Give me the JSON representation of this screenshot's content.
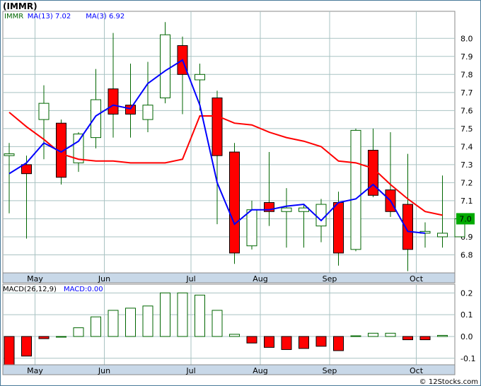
{
  "ticker_label": "(IMMR)",
  "watermark": "© 12Stocks.com",
  "colors": {
    "up_fill": "#ffffff",
    "up_stroke": "#006600",
    "down_fill": "#ff0000",
    "wick": "#006600",
    "ma13": "#ff0000",
    "ma3": "#0000ff",
    "grid": "#a9c3c3",
    "panel_bg": "#ffffff",
    "axis_band": "#c8d8e8",
    "last_price_box": "#00aa00"
  },
  "chart_data": [
    {
      "type": "candlestick",
      "title": "",
      "legend": [
        {
          "label": "IMMR",
          "value": "",
          "color": "#006600"
        },
        {
          "label": "MA(13)",
          "value": "7.02",
          "color": "#0000ff"
        },
        {
          "label": "MA(3)",
          "value": "6.92",
          "color": "#0000ff"
        }
      ],
      "ylim": [
        6.7,
        8.15
      ],
      "yticks": [
        "6.8",
        "6.9",
        "7.0",
        "7.1",
        "7.2",
        "7.3",
        "7.4",
        "7.5",
        "7.6",
        "7.7",
        "7.8",
        "7.9",
        "8.0"
      ],
      "xlabels": [
        {
          "label": "May",
          "index": 1
        },
        {
          "label": "Jun",
          "index": 5
        },
        {
          "label": "Jul",
          "index": 10
        },
        {
          "label": "Aug",
          "index": 14
        },
        {
          "label": "Sep",
          "index": 18
        },
        {
          "label": "Oct",
          "index": 23
        }
      ],
      "last_price": "7.0",
      "candles": [
        {
          "o": 7.35,
          "h": 7.42,
          "l": 7.03,
          "c": 7.36
        },
        {
          "o": 7.3,
          "h": 7.35,
          "l": 6.89,
          "c": 7.25
        },
        {
          "o": 7.55,
          "h": 7.74,
          "l": 7.33,
          "c": 7.64
        },
        {
          "o": 7.53,
          "h": 7.55,
          "l": 7.19,
          "c": 7.23
        },
        {
          "o": 7.31,
          "h": 7.48,
          "l": 7.26,
          "c": 7.47
        },
        {
          "o": 7.45,
          "h": 7.83,
          "l": 7.39,
          "c": 7.66
        },
        {
          "o": 7.72,
          "h": 8.03,
          "l": 7.45,
          "c": 7.58
        },
        {
          "o": 7.63,
          "h": 7.86,
          "l": 7.45,
          "c": 7.58
        },
        {
          "o": 7.55,
          "h": 7.87,
          "l": 7.48,
          "c": 7.63
        },
        {
          "o": 7.67,
          "h": 8.09,
          "l": 7.64,
          "c": 8.02
        },
        {
          "o": 7.96,
          "h": 8.01,
          "l": 7.58,
          "c": 7.8
        },
        {
          "o": 7.77,
          "h": 7.86,
          "l": 7.6,
          "c": 7.8
        },
        {
          "o": 7.67,
          "h": 7.71,
          "l": 6.97,
          "c": 7.35
        },
        {
          "o": 7.37,
          "h": 7.42,
          "l": 6.75,
          "c": 6.81
        },
        {
          "o": 6.85,
          "h": 7.1,
          "l": 6.83,
          "c": 7.05
        },
        {
          "o": 7.09,
          "h": 7.37,
          "l": 6.96,
          "c": 7.04
        },
        {
          "o": 7.04,
          "h": 7.17,
          "l": 6.84,
          "c": 7.06
        },
        {
          "o": 7.04,
          "h": 7.08,
          "l": 6.84,
          "c": 7.06
        },
        {
          "o": 6.96,
          "h": 7.11,
          "l": 6.87,
          "c": 7.08
        },
        {
          "o": 7.09,
          "h": 7.15,
          "l": 6.74,
          "c": 6.81
        },
        {
          "o": 6.83,
          "h": 7.5,
          "l": 6.82,
          "c": 7.49
        },
        {
          "o": 7.38,
          "h": 7.5,
          "l": 7.12,
          "c": 7.13
        },
        {
          "o": 7.16,
          "h": 7.48,
          "l": 7.01,
          "c": 7.04
        },
        {
          "o": 7.08,
          "h": 7.36,
          "l": 6.71,
          "c": 6.83
        },
        {
          "o": 6.92,
          "h": 6.98,
          "l": 6.84,
          "c": 6.93
        },
        {
          "o": 6.9,
          "h": 7.24,
          "l": 6.84,
          "c": 6.92
        },
        {
          "o": 6.9,
          "h": 7.03,
          "l": 6.9,
          "c": 7.0
        }
      ],
      "ma13": [
        7.59,
        7.51,
        7.44,
        7.36,
        7.33,
        7.32,
        7.32,
        7.31,
        7.31,
        7.31,
        7.33,
        7.57,
        7.57,
        7.53,
        7.52,
        7.48,
        7.45,
        7.43,
        7.4,
        7.32,
        7.31,
        7.28,
        7.19,
        7.11,
        7.04,
        7.02
      ],
      "ma3": [
        7.25,
        7.31,
        7.42,
        7.37,
        7.43,
        7.57,
        7.63,
        7.61,
        7.75,
        7.82,
        7.88,
        7.63,
        7.2,
        6.97,
        7.05,
        7.05,
        7.07,
        7.08,
        6.99,
        7.09,
        7.11,
        7.19,
        7.1,
        6.93,
        6.92
      ]
    },
    {
      "type": "bar",
      "title": "",
      "legend": [
        {
          "label": "MACD(26,12,9)",
          "value": "",
          "color": "#000000"
        },
        {
          "label": "MACD:",
          "value": "0.00",
          "color": "#0000ff"
        }
      ],
      "ylim": [
        -0.13,
        0.24
      ],
      "yticks": [
        "-0.1",
        "0.0",
        "0.1",
        "0.2"
      ],
      "xlabels": [
        {
          "label": "May",
          "index": 1
        },
        {
          "label": "Jun",
          "index": 5
        },
        {
          "label": "Jul",
          "index": 10
        },
        {
          "label": "Aug",
          "index": 14
        },
        {
          "label": "Sep",
          "index": 18
        },
        {
          "label": "Oct",
          "index": 23
        }
      ],
      "values": [
        -0.13,
        -0.09,
        -0.01,
        0.0,
        0.04,
        0.09,
        0.12,
        0.13,
        0.14,
        0.2,
        0.2,
        0.19,
        0.12,
        0.01,
        -0.03,
        -0.05,
        -0.06,
        -0.055,
        -0.045,
        -0.065,
        0.003,
        0.015,
        0.015,
        -0.015,
        -0.015,
        0.005
      ]
    }
  ]
}
